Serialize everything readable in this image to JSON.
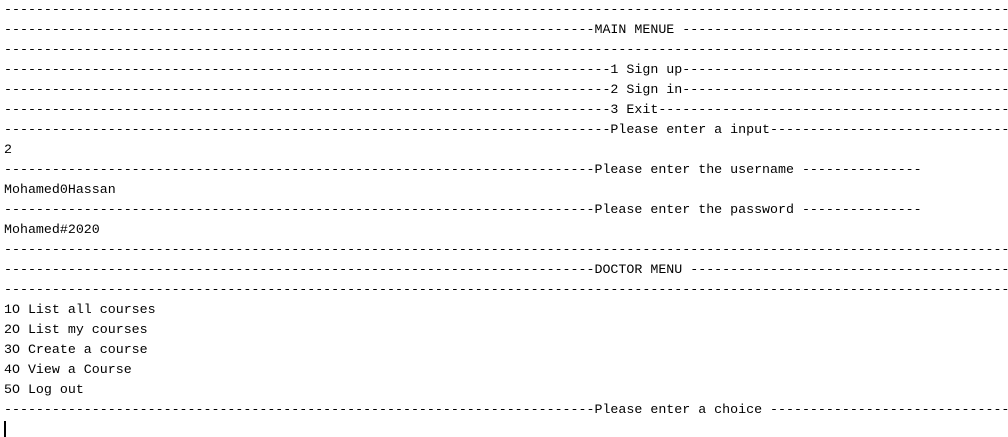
{
  "console": {
    "lines": [
      "-----------------------------------------------------------------------------------------------------------------------------------------------------",
      "--------------------------------------------------------------------------MAIN MENUE ---------------------------------------------------------------",
      "-----------------------------------------------------------------------------------------------------------------------------------------------------",
      "----------------------------------------------------------------------------1 Sign up-------------------------------------------------------------",
      "----------------------------------------------------------------------------2 Sign in-------------------------------------------------------------",
      "----------------------------------------------------------------------------3 Exit----------------------------------------------------------------",
      "----------------------------------------------------------------------------Please enter a input---------------------------------------------------",
      "2",
      "--------------------------------------------------------------------------Please enter the username ---------------",
      "Mohamed0Hassan",
      "--------------------------------------------------------------------------Please enter the password ---------------",
      "Mohamed#2020",
      "-----------------------------------------------------------------------------------------------------------------------------------------------------",
      "--------------------------------------------------------------------------DOCTOR MENU -----------------------------------------------------",
      "-----------------------------------------------------------------------------------------------------------------------------------------------------",
      "1O List all courses",
      "2O List my courses",
      "3O Create a course",
      "4O View a Course",
      "5O Log out",
      "--------------------------------------------------------------------------Please enter a choice -------------------------------------"
    ]
  }
}
